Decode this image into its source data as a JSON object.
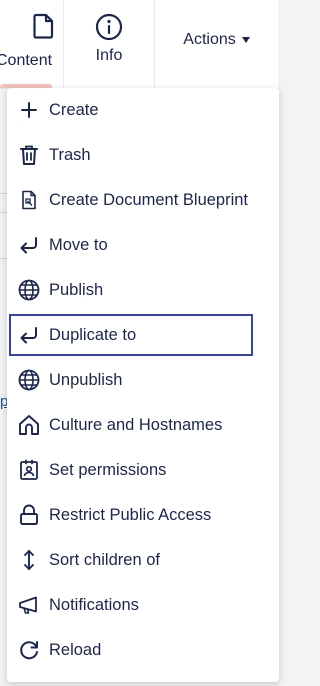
{
  "tabs": {
    "content_label": "Content",
    "info_label": "Info"
  },
  "actions": {
    "label": "Actions"
  },
  "background": {
    "link_text": "p"
  },
  "menu": {
    "items": [
      {
        "label": "Create",
        "icon": "add-icon"
      },
      {
        "label": "Trash",
        "icon": "trash-icon"
      },
      {
        "label": "Create Document Blueprint",
        "icon": "blueprint-icon"
      },
      {
        "label": "Move to",
        "icon": "move-icon"
      },
      {
        "label": "Publish",
        "icon": "globe-icon"
      },
      {
        "label": "Duplicate to",
        "icon": "duplicate-icon",
        "focused": true
      },
      {
        "label": "Unpublish",
        "icon": "globe-icon"
      },
      {
        "label": "Culture and Hostnames",
        "icon": "home-icon"
      },
      {
        "label": "Set permissions",
        "icon": "permissions-icon"
      },
      {
        "label": "Restrict Public Access",
        "icon": "lock-icon"
      },
      {
        "label": "Sort children of",
        "icon": "sort-icon"
      },
      {
        "label": "Notifications",
        "icon": "megaphone-icon"
      },
      {
        "label": "Reload",
        "icon": "reload-icon"
      }
    ]
  },
  "colors": {
    "text": "#1b264f",
    "focus_outline": "#3544b1",
    "active_tab_bar": "#f5c1bc"
  }
}
